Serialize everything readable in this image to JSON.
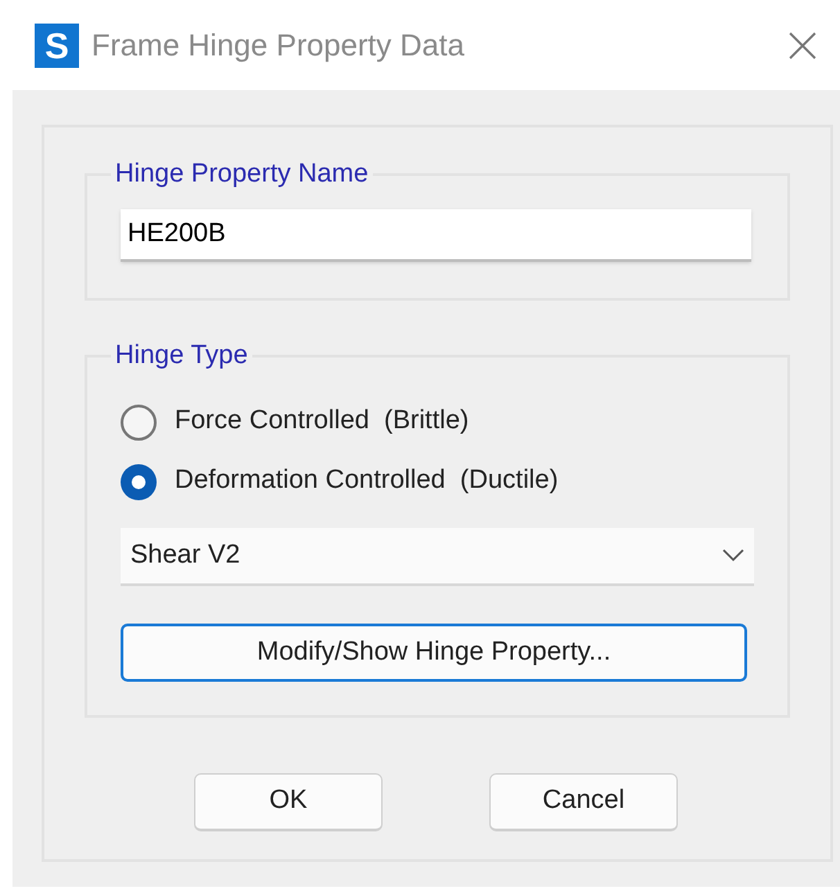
{
  "window": {
    "title": "Frame Hinge Property Data",
    "icon_letter": "S"
  },
  "hinge_property_name": {
    "legend": "Hinge Property Name",
    "value": "HE200B"
  },
  "hinge_type": {
    "legend": "Hinge Type",
    "options": [
      {
        "label": "Force Controlled  (Brittle)",
        "selected": false
      },
      {
        "label": "Deformation Controlled  (Ductile)",
        "selected": true
      }
    ],
    "dropdown": "Shear V2",
    "button": "Modify/Show Hinge Property..."
  },
  "buttons": [
    "OK",
    "Cancel"
  ]
}
